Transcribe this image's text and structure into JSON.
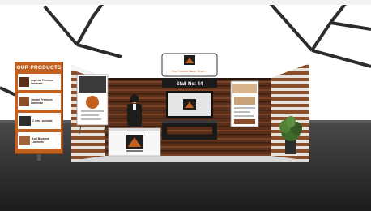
{
  "products_panel": {
    "title": "OUR PRODUCTS",
    "items": [
      {
        "label": "Imperial Premium Laminate"
      },
      {
        "label": "Ornate Premium Laminate"
      },
      {
        "label": "1 mm Laminate"
      },
      {
        "label": "Anti Bacterial Laminate"
      }
    ]
  },
  "booth": {
    "header_sign": "Your Trusted Name Since ...",
    "stall_label": "Stall No: 44"
  },
  "colors": {
    "brand_orange": "#c1601f",
    "wood_dark": "#4a2616",
    "floor": "#3a3a3a"
  }
}
